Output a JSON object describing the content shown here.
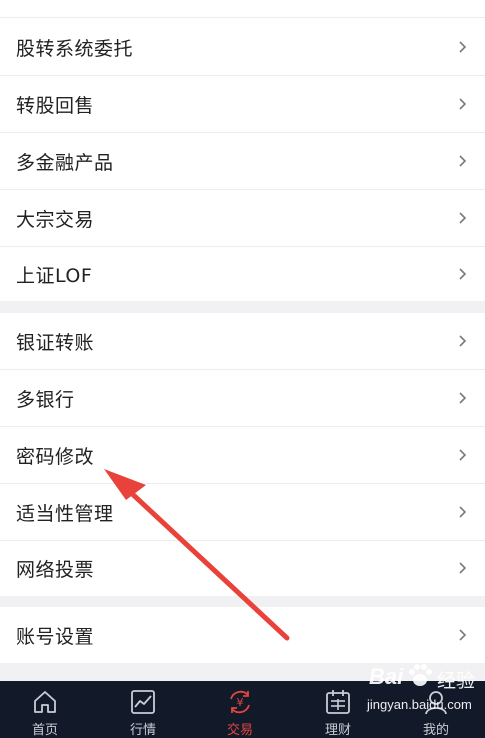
{
  "menu_group_1": [
    {
      "label": "股转系统委托"
    },
    {
      "label": "转股回售"
    },
    {
      "label": "多金融产品"
    },
    {
      "label": "大宗交易"
    },
    {
      "label": "上证LOF"
    }
  ],
  "menu_group_2": [
    {
      "label": "银证转账"
    },
    {
      "label": "多银行"
    },
    {
      "label": "密码修改"
    },
    {
      "label": "适当性管理"
    },
    {
      "label": "网络投票"
    }
  ],
  "menu_group_3": [
    {
      "label": "账号设置"
    }
  ],
  "tabbar": {
    "home": "首页",
    "quotes": "行情",
    "trade": "交易",
    "finance": "理财",
    "mine": "我的",
    "active": "trade"
  },
  "watermark": {
    "brand_text": "Bai",
    "brand_cn": "经验",
    "url": "jingyan.baidu.com"
  },
  "colors": {
    "accent": "#e0463e",
    "arrow": "#e8423a",
    "tabbar_bg": "#121a2a"
  }
}
